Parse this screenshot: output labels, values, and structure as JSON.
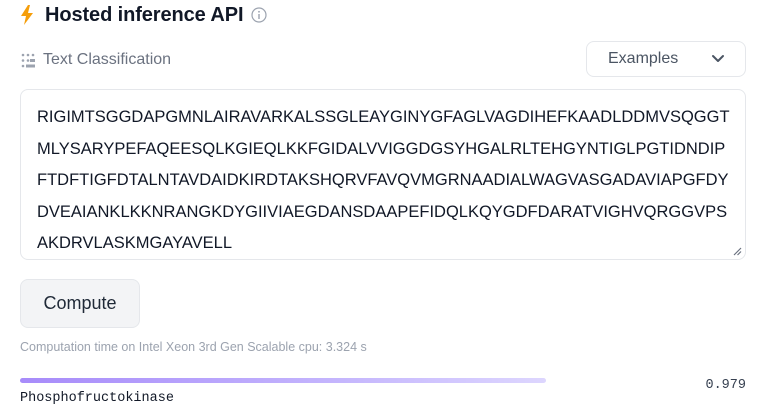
{
  "header": {
    "title": "Hosted inference API",
    "icon": "lightning-icon",
    "info_icon": "info-icon",
    "accent": "#f59e0b"
  },
  "task": {
    "label": "Text Classification",
    "icon": "text-classification-icon"
  },
  "examples": {
    "label": "Examples",
    "icon": "chevron-down-icon"
  },
  "input": {
    "value": "RIGIMTSGGDAPGMNLAIRAVARKALSSGLEAYGINYGFAGLVAGDIHEFKAADLDDMVSQGGTMLYSARYPEFAQEESQLKGIEQLKKFGIDALVVIGGDGSYHGALRLTEHGYNTIGLPGTIDNDIPFTDFTIGFDTALNTAVDAIDKIRDTAKSHQRVFAVQVMGRNAADIALWAGVASGADAVIAPGFDYDVEAIANKLKKNRANGKDYGIIVIAEGDANSDAAPEFIDQLKQYGDFDARATVIGHVQRGGVPSAKDRVLASKMGAYAVELL"
  },
  "compute_button": {
    "label": "Compute"
  },
  "computation_time": "Computation time on Intel Xeon 3rd Gen Scalable cpu: 3.324 s",
  "results": [
    {
      "label": "Phosphofructokinase",
      "score": "0.979",
      "fraction": 0.979
    }
  ]
}
